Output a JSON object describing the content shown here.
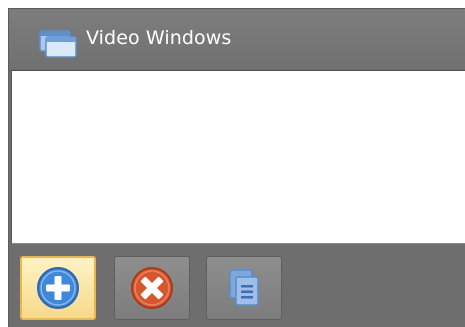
{
  "panel": {
    "title": "Video Windows",
    "title_icon": "folder-windows-icon"
  },
  "toolbar": {
    "buttons": [
      {
        "id": "add",
        "icon": "plus-circle-icon",
        "state": "highlighted"
      },
      {
        "id": "remove",
        "icon": "close-circle-icon",
        "state": "normal"
      },
      {
        "id": "list",
        "icon": "document-list-icon",
        "state": "normal"
      }
    ]
  },
  "colors": {
    "panel_bg": "#6e6e6e",
    "list_bg": "#ffffff",
    "add_accent": "#3f87d9",
    "remove_accent": "#d8562e",
    "list_accent": "#5b8cc9",
    "highlight_border": "#e7b94d"
  }
}
